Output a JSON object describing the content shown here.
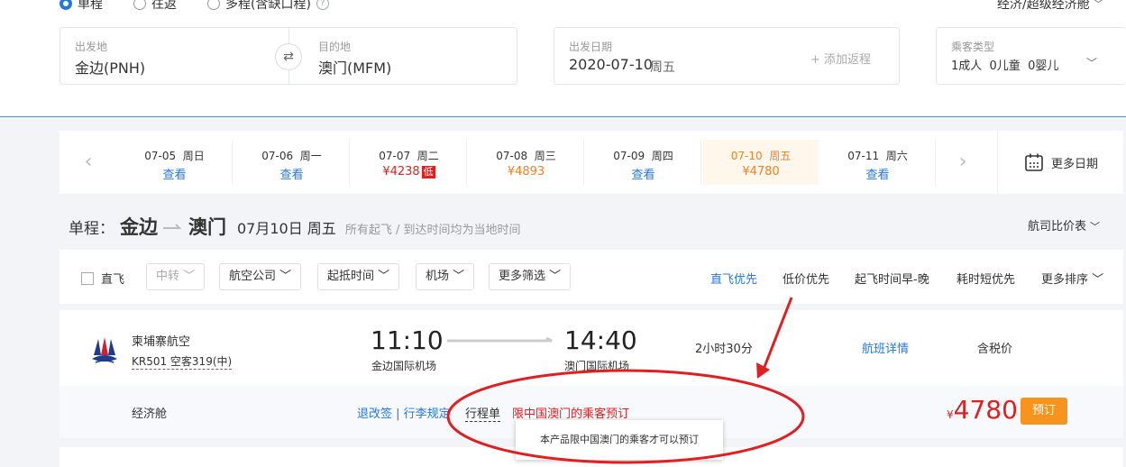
{
  "trip_types": [
    {
      "label": "单程",
      "selected": true
    },
    {
      "label": "往返",
      "selected": false
    },
    {
      "label": "多程(含缺口程)",
      "selected": false
    }
  ],
  "cabin_class": "经济/超级经济舱",
  "search": {
    "from_label": "出发地",
    "from_value": "金边(PNH)",
    "to_label": "目的地",
    "to_value": "澳门(MFM)",
    "date_label": "出发日期",
    "date_value": "2020-07-10",
    "date_weekday": "周五",
    "add_return": "+ 添加返程",
    "passenger_label": "乘客类型",
    "passenger_value": "1成人  0儿童  0婴儿"
  },
  "dates": [
    {
      "date": "07-05  周日",
      "price": "查看"
    },
    {
      "date": "07-06  周一",
      "price": "查看"
    },
    {
      "date": "07-07  周二",
      "price": "¥4238",
      "badge": "低"
    },
    {
      "date": "07-08  周三",
      "price": "¥4893"
    },
    {
      "date": "07-09  周四",
      "price": "查看"
    },
    {
      "date": "07-10  周五",
      "price": "¥4780"
    },
    {
      "date": "07-11  周六",
      "price": "查看"
    }
  ],
  "more_dates": "更多日期",
  "route": {
    "prefix": "单程：",
    "from": "金边",
    "to": "澳门",
    "date": "07月10日 周五",
    "note": "所有起飞 / 到达时间均为当地时间",
    "compare": "航司比价表"
  },
  "filters": {
    "direct": "直飞",
    "transfer": "中转",
    "airline": "航空公司",
    "time": "起抵时间",
    "airport": "机场",
    "more": "更多筛选"
  },
  "sorts": {
    "direct_first": "直飞优先",
    "low_price": "低价优先",
    "early": "起飞时间早-晚",
    "short": "耗时短优先",
    "more": "更多排序"
  },
  "flight": {
    "airline": "柬埔寨航空",
    "flight_no": "KR501 空客319(中)",
    "dep_time": "11:10",
    "dep_airport": "金边国际机场",
    "arr_time": "14:40",
    "arr_airport": "澳门国际机场",
    "duration": "2小时30分",
    "details": "航班详情",
    "tax_label": "含税价",
    "cabin": "经济舱",
    "rules": "退改签 | 行李规定",
    "itinerary": "行程单",
    "restriction": "限中国澳门的乘客预订",
    "currency": "¥",
    "price": "4780",
    "book": "预订",
    "tooltip": "本产品限中国澳门的乘客才可以预订"
  },
  "colors": {
    "accent": "#2577e3",
    "price_red": "#e02020",
    "orange": "#f77f1e",
    "book_btn": "#f7941d"
  }
}
